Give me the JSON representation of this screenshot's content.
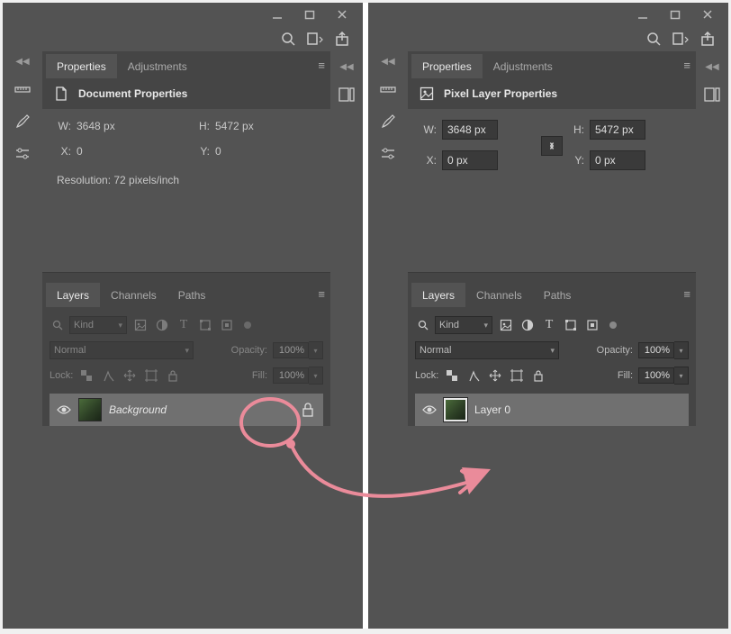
{
  "window_buttons": {
    "min": "–",
    "max": "□",
    "close": "×"
  },
  "tabs": {
    "properties": "Properties",
    "adjustments": "Adjustments",
    "layers": "Layers",
    "channels": "Channels",
    "paths": "Paths"
  },
  "left": {
    "props_title": "Document Properties",
    "w_label": "W:",
    "w_value": "3648 px",
    "h_label": "H:",
    "h_value": "5472 px",
    "x_label": "X:",
    "x_value": "0",
    "y_label": "Y:",
    "y_value": "0",
    "resolution": "Resolution: 72 pixels/inch",
    "kind": "Kind",
    "blend_mode": "Normal",
    "opacity_label": "Opacity:",
    "opacity_value": "100%",
    "fill_label": "Fill:",
    "fill_value": "100%",
    "lock_label": "Lock:",
    "layer_name": "Background"
  },
  "right": {
    "props_title": "Pixel Layer Properties",
    "w_label": "W:",
    "w_value": "3648 px",
    "h_label": "H:",
    "h_value": "5472 px",
    "x_label": "X:",
    "x_value": "0 px",
    "y_label": "Y:",
    "y_value": "0 px",
    "kind": "Kind",
    "blend_mode": "Normal",
    "opacity_label": "Opacity:",
    "opacity_value": "100%",
    "fill_label": "Fill:",
    "fill_value": "100%",
    "lock_label": "Lock:",
    "layer_name": "Layer 0"
  },
  "icons": {
    "search": "search-icon",
    "arrange": "arrange-icon",
    "share": "share-icon"
  }
}
